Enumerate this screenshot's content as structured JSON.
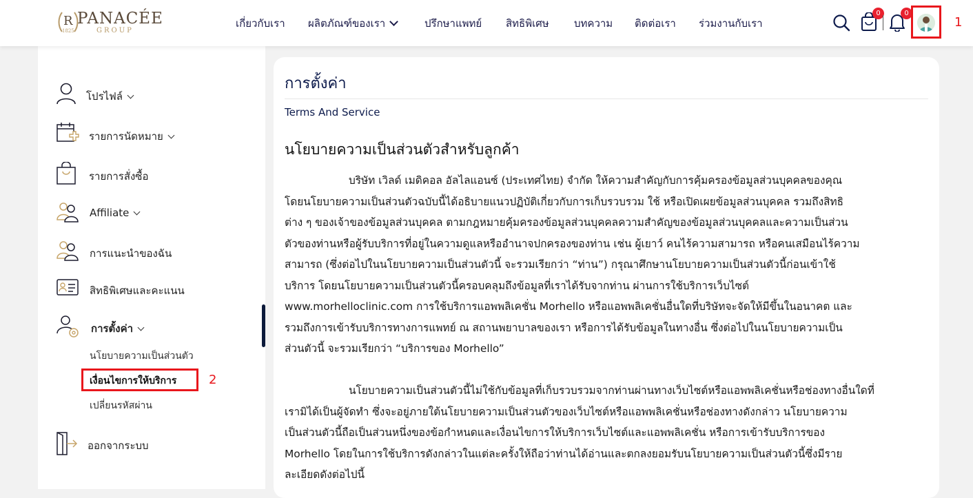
{
  "header": {
    "logo_text": "PANACÉE",
    "logo_sub": "GROUP",
    "logo_year": "1825",
    "nav": [
      {
        "label": "เกี่ยวกับเรา"
      },
      {
        "label": "ผลิตภัณฑ์ของเรา"
      },
      {
        "label": "ปรึกษาแพทย์"
      },
      {
        "label": "สิทธิพิเศษ"
      },
      {
        "label": "บทความ"
      },
      {
        "label": "ติดต่อเรา"
      },
      {
        "label": "ร่วมงานกับเรา"
      }
    ],
    "cart_count": "0",
    "notification_count": "0",
    "annotation_1": "1"
  },
  "sidebar": {
    "items": [
      {
        "label": "โปรไฟล์"
      },
      {
        "label": "รายการนัดหมาย"
      },
      {
        "label": "รายการสั่งซื้อ"
      },
      {
        "label": "Affiliate"
      },
      {
        "label": "การแนะนำของฉัน"
      },
      {
        "label": "สิทธิพิเศษและคะแนน"
      },
      {
        "label": "การตั้งค่า"
      },
      {
        "label": "ออกจากระบบ"
      }
    ],
    "settings_sub": [
      {
        "label": "นโยบายความเป็นส่วนตัว"
      },
      {
        "label": "เงื่อนไขการให้บริการ"
      },
      {
        "label": "เปลี่ยนรหัสผ่าน"
      }
    ],
    "annotation_2": "2"
  },
  "content": {
    "title": "การตั้งค่า",
    "subtitle": "Terms And Service",
    "heading": "นโยบายความเป็นส่วนตัวสำหรับลูกค้า",
    "para1": [
      "                   บริษัท  เวิลด์ เมดิคอล อัลไลแอนซ์ (ประเทศไทย) จำกัด ให้ความสำคัญกับการคุ้มครองข้อมูลส่วนบุคคลของคุณ",
      "โดยนโยบายความเป็นส่วนตัวฉบับนี้ได้อธิบายแนวปฏิบัติเกี่ยวกับการเก็บรวบรวม ใช้ หรือเปิดเผยข้อมูลส่วนบุคคล รวมถึงสิทธิ",
      "ต่าง ๆ ของเจ้าของข้อมูลส่วนบุคคล ตามกฎหมายคุ้มครองข้อมูลส่วนบุคคลความสำคัญของข้อมูลส่วนบุคคลและความเป็นส่วน",
      "ตัวของท่านหรือผู้รับบริการที่อยู่ในความดูแลหรืออำนาจปกครองของท่าน เช่น ผู้เยาว์ คนไร้ความสามารถ หรือคนเสมือนไร้ความ",
      "สามารถ (ซึ่งต่อไปในนโยบายความเป็นส่วนตัวนี้ จะรวมเรียกว่า “ท่าน”)       กรุณาศึกษานโยบายความเป็นส่วนตัวนี้ก่อนเข้าใช้",
      "บริการ โดยนโยบายความเป็นส่วนตัวนี้ครอบคลุมถึงข้อมูลที่เราได้รับจากท่าน  ผ่านการใช้บริการเว็บไซต์",
      "www.morhelloclinic.com  การใช้บริการแอพพลิเคชั่น Morhello หรือแอพพลิเคชั่นอื่นใดที่บริษัทจะจัดให้มีขึ้นในอนาคต  และ",
      "รวมถึงการเข้ารับบริการทางการแพทย์ ณ สถานพยาบาลของเรา หรือการได้รับข้อมูลในทางอื่น ซึ่งต่อไปในนโยบายความเป็น",
      "ส่วนตัวนี้ จะรวมเรียกว่า “บริการของ Morhello”"
    ],
    "para2": [
      "                   นโยบายความเป็นส่วนตัวนี้ไม่ใช้กับข้อมูลที่เก็บรวบรวมจากท่านผ่านทางเว็บไซต์หรือแอพพลิเคชั่นหรือช่องทางอื่นใดที่",
      "เรามิได้เป็นผู้จัดทำ ซึ่งจะอยู่ภายใต้นโยบายความเป็นส่วนตัวของเว็บไซต์หรือแอพพลิเคชั่นหรือช่องทางดังกล่าว นโยบายความ",
      "เป็นส่วนตัวนี้ถือเป็นส่วนหนึ่งของข้อกำหนดและเงื่อนไขการให้บริการเว็บไซต์และแอพพลิเคชั่น หรือการเข้ารับบริการของ",
      "Morhello โดยในการใช้บริการดังกล่าวในแต่ละครั้งให้ถือว่าท่านได้อ่านและตกลงยอมรับนโยบายความเป็นส่วนตัวนี้ซึ่งมีราย",
      "ละเอียดดังต่อไปนี้"
    ]
  }
}
